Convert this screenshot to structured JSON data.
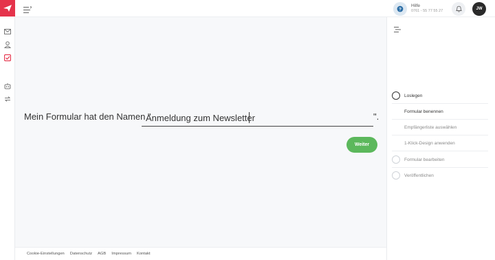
{
  "nav": {
    "icons": [
      "envelope-icon",
      "user-icon",
      "checklist-icon",
      "automation-icon",
      "transfer-icon"
    ],
    "accent": "#e5334b"
  },
  "header": {
    "help_title": "Hilfe",
    "help_phone": "0761 - 55 77 55 27",
    "avatar_initials": "JW"
  },
  "form": {
    "sentence": "Mein Formular hat den Namen \"",
    "name_value": "Anmeldung zum Newsletter",
    "trailing": "\".",
    "next_label": "Weiter",
    "button_color": "#5cb85c"
  },
  "steps": {
    "items": [
      {
        "label": "Loslegen"
      },
      {
        "label": "Formular benennen"
      },
      {
        "label": "Empfängerliste auswählen"
      },
      {
        "label": "1-Klick-Design anwenden"
      },
      {
        "label": "Formular bearbeiten"
      },
      {
        "label": "Veröffentlichen"
      }
    ]
  },
  "footer": {
    "links": [
      "Cookie-Einstellungen",
      "Datenschutz",
      "AGB",
      "Impressum",
      "Kontakt"
    ]
  }
}
